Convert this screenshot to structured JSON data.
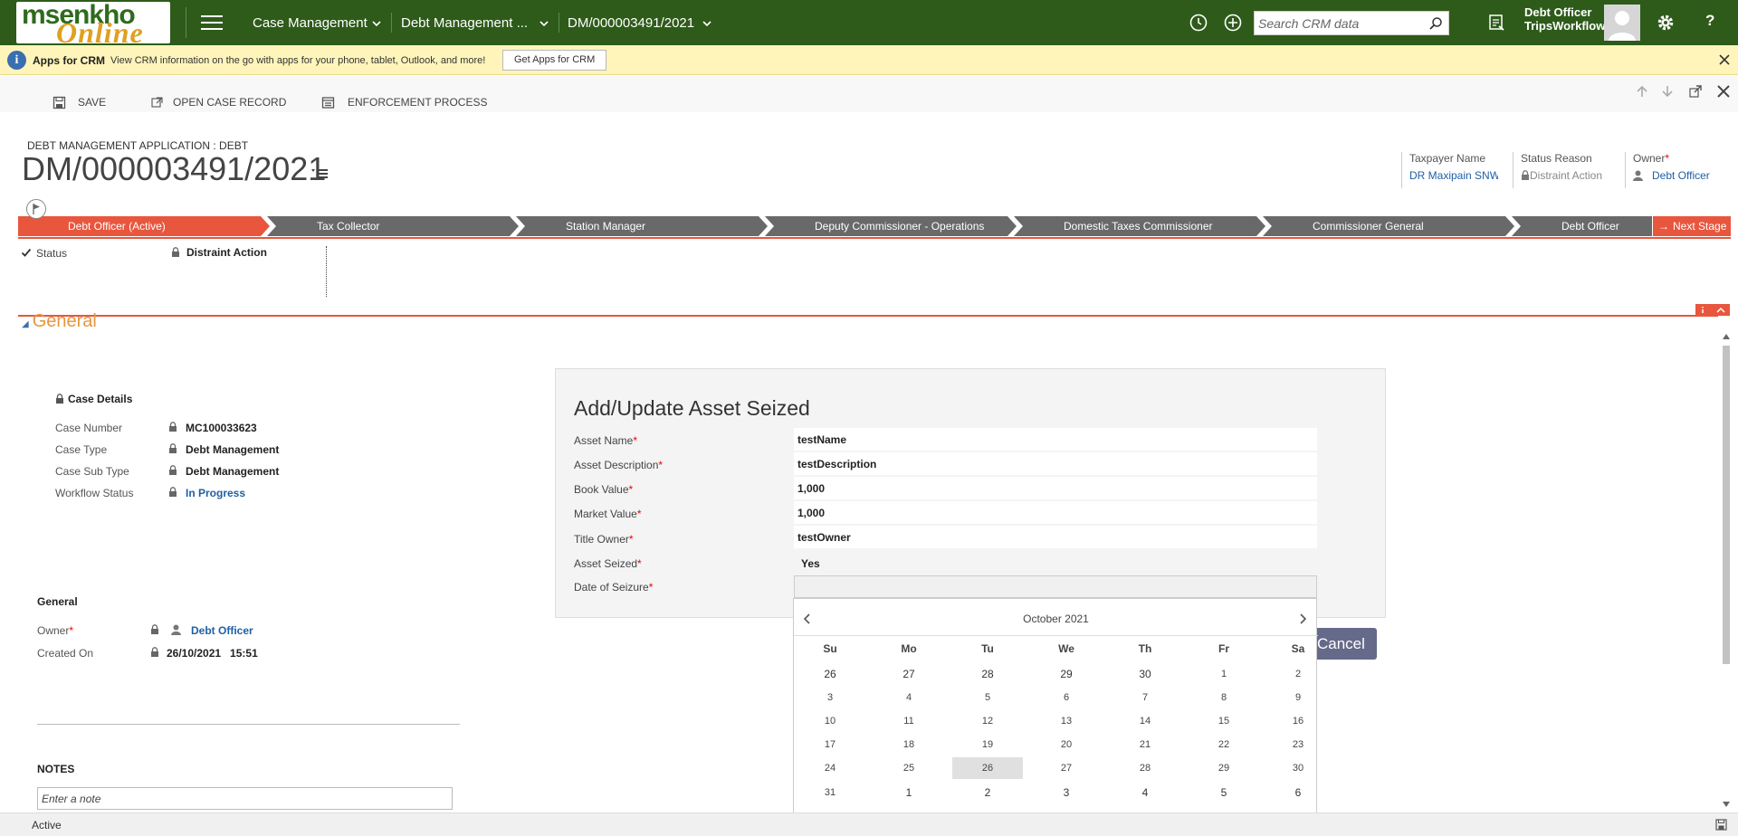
{
  "logo": {
    "line1": "msenkho",
    "line2": "Online"
  },
  "nav": {
    "area": "Case Management",
    "entity": "Debt Management ...",
    "record": "DM/000003491/2021",
    "search_placeholder": "Search CRM data",
    "user_role": "Debt Officer",
    "user_org": "TripsWorkflow",
    "help": "?"
  },
  "notification": {
    "title": "Apps for CRM",
    "text": "View CRM information on the go with apps for your phone, tablet, Outlook, and more!",
    "button": "Get Apps for CRM",
    "info": "i"
  },
  "commands": {
    "save": "SAVE",
    "open_case": "OPEN CASE RECORD",
    "enforcement": "ENFORCEMENT PROCESS"
  },
  "header": {
    "entity_label": "DEBT MANAGEMENT APPLICATION : DEBT",
    "title": "DM/000003491/2021",
    "fields": {
      "taxpayer_label": "Taxpayer Name",
      "taxpayer_value": "DR Maxipain SNW",
      "status_reason_label": "Status Reason",
      "status_reason_value": "Distraint Action",
      "owner_label": "Owner",
      "owner_value": "Debt Officer"
    }
  },
  "process": {
    "stages": [
      "Debt Officer (Active)",
      "Tax Collector",
      "Station Manager",
      "Deputy Commissioner - Operations",
      "Domestic Taxes Commissioner",
      "Commissioner General",
      "Debt Officer"
    ],
    "next_stage": "Next Stage",
    "status_label": "Status",
    "status_value": "Distraint Action",
    "active_color": "#e8563e",
    "inactive_color": "#696969"
  },
  "section": {
    "heading": "General"
  },
  "case_details": {
    "title": "Case Details",
    "rows": [
      {
        "label": "Case Number",
        "value": "MC100033623"
      },
      {
        "label": "Case Type",
        "value": "Debt Management"
      },
      {
        "label": "Case Sub Type",
        "value": "Debt Management"
      },
      {
        "label": "Workflow Status",
        "value": "In Progress"
      }
    ]
  },
  "general": {
    "title": "General",
    "owner_label": "Owner",
    "owner_value": "Debt Officer",
    "created_label": "Created On",
    "created_value": "26/10/2021   15:51"
  },
  "notes": {
    "title": "NOTES",
    "placeholder": "Enter a note"
  },
  "dialog": {
    "title": "Add/Update Asset Seized",
    "fields": [
      {
        "label": "Asset Name",
        "value": "testName"
      },
      {
        "label": "Asset Description",
        "value": "testDescription"
      },
      {
        "label": "Book Value",
        "value": "1,000"
      },
      {
        "label": "Market Value",
        "value": "1,000"
      },
      {
        "label": "Title Owner",
        "value": "testOwner"
      },
      {
        "label": "Asset Seized",
        "value": "Yes"
      },
      {
        "label": "Date of Seizure",
        "value": ""
      }
    ],
    "cancel": "Cancel"
  },
  "calendar": {
    "month": "October 2021",
    "weekdays": [
      "Su",
      "Mo",
      "Tu",
      "We",
      "Th",
      "Fr",
      "Sa"
    ],
    "weeks": [
      [
        "26",
        "27",
        "28",
        "29",
        "30",
        "1",
        "2"
      ],
      [
        "3",
        "4",
        "5",
        "6",
        "7",
        "8",
        "9"
      ],
      [
        "10",
        "11",
        "12",
        "13",
        "14",
        "15",
        "16"
      ],
      [
        "17",
        "18",
        "19",
        "20",
        "21",
        "22",
        "23"
      ],
      [
        "24",
        "25",
        "26",
        "27",
        "28",
        "29",
        "30"
      ],
      [
        "31",
        "1",
        "2",
        "3",
        "4",
        "5",
        "6"
      ]
    ],
    "today": "26"
  },
  "footer": {
    "status": "Active"
  }
}
